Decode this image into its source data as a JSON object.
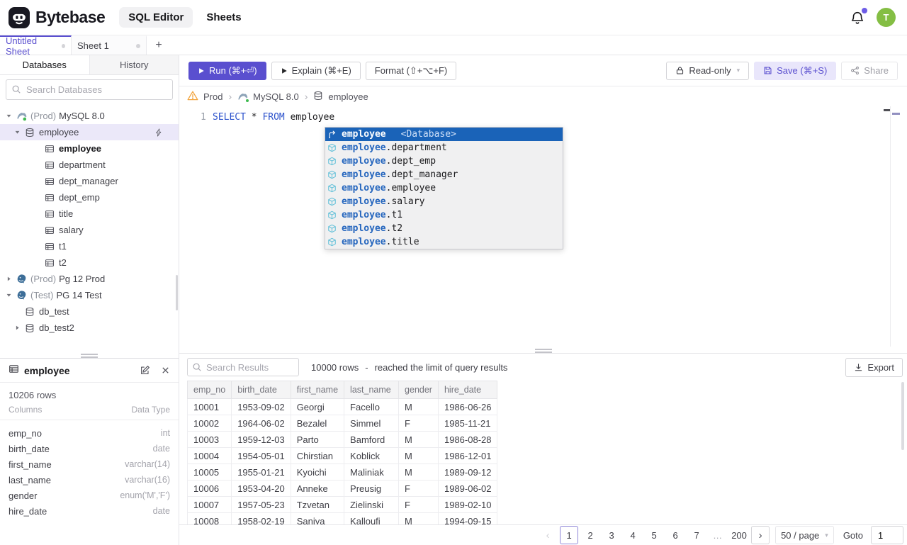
{
  "header": {
    "brand": "Bytebase",
    "nav_sql_editor": "SQL Editor",
    "nav_sheets": "Sheets",
    "avatar_initial": "T"
  },
  "sheet_tabs": {
    "tabs": [
      {
        "label": "Untitled Sheet",
        "active": true
      },
      {
        "label": "Sheet 1",
        "active": false
      }
    ],
    "add_label": "+"
  },
  "sidebar": {
    "tab_databases": "Databases",
    "tab_history": "History",
    "search_placeholder": "Search Databases",
    "tree": [
      {
        "level": 1,
        "icon": "mysql",
        "caret": "down",
        "prefix": "(Prod)",
        "label": "MySQL 8.0"
      },
      {
        "level": 2,
        "icon": "database",
        "caret": "down",
        "label": "employee",
        "selected": true,
        "bolt": true
      },
      {
        "level": 3,
        "icon": "table",
        "caret": "none",
        "label": "employee",
        "bold": true
      },
      {
        "level": 3,
        "icon": "table",
        "caret": "none",
        "label": "department"
      },
      {
        "level": 3,
        "icon": "table",
        "caret": "none",
        "label": "dept_manager"
      },
      {
        "level": 3,
        "icon": "table",
        "caret": "none",
        "label": "dept_emp"
      },
      {
        "level": 3,
        "icon": "table",
        "caret": "none",
        "label": "title"
      },
      {
        "level": 3,
        "icon": "table",
        "caret": "none",
        "label": "salary"
      },
      {
        "level": 3,
        "icon": "table",
        "caret": "none",
        "label": "t1"
      },
      {
        "level": 3,
        "icon": "table",
        "caret": "none",
        "label": "t2"
      },
      {
        "level": 1,
        "icon": "postgres",
        "caret": "right",
        "prefix": "(Prod)",
        "label": "Pg 12 Prod"
      },
      {
        "level": 1,
        "icon": "postgres",
        "caret": "down",
        "prefix": "(Test)",
        "label": "PG 14 Test"
      },
      {
        "level": 2,
        "icon": "database",
        "caret": "none",
        "label": "db_test"
      },
      {
        "level": 2,
        "icon": "database",
        "caret": "right",
        "label": "db_test2"
      }
    ]
  },
  "schema_panel": {
    "table_name": "employee",
    "row_count": "10206 rows",
    "columns_label": "Columns",
    "datatype_label": "Data Type",
    "columns": [
      {
        "name": "emp_no",
        "type": "int"
      },
      {
        "name": "birth_date",
        "type": "date"
      },
      {
        "name": "first_name",
        "type": "varchar(14)"
      },
      {
        "name": "last_name",
        "type": "varchar(16)"
      },
      {
        "name": "gender",
        "type": "enum('M','F')"
      },
      {
        "name": "hire_date",
        "type": "date"
      }
    ]
  },
  "toolbar": {
    "run_label": "Run (⌘+⏎)",
    "explain_label": "Explain (⌘+E)",
    "format_label": "Format (⇧+⌥+F)",
    "readonly_label": "Read-only",
    "save_label": "Save (⌘+S)",
    "share_label": "Share"
  },
  "breadcrumb": {
    "environment": "Prod",
    "instance": "MySQL 8.0",
    "database": "employee"
  },
  "editor": {
    "line_number": "1",
    "keyword1": "SELECT",
    "star": "*",
    "keyword2": "FROM",
    "table": "employee"
  },
  "autocomplete": {
    "selected": {
      "label": "employee",
      "detail": "<Database>"
    },
    "items": [
      {
        "prefix": "employee",
        "suffix": ".department"
      },
      {
        "prefix": "employee",
        "suffix": ".dept_emp"
      },
      {
        "prefix": "employee",
        "suffix": ".dept_manager"
      },
      {
        "prefix": "employee",
        "suffix": ".employee"
      },
      {
        "prefix": "employee",
        "suffix": ".salary"
      },
      {
        "prefix": "employee",
        "suffix": ".t1"
      },
      {
        "prefix": "employee",
        "suffix": ".t2"
      },
      {
        "prefix": "employee",
        "suffix": ".title"
      }
    ]
  },
  "results": {
    "search_placeholder": "Search Results",
    "row_count": "10000 rows",
    "separator": "-",
    "limit_note": "reached the limit of query results",
    "export_label": "Export",
    "columns": [
      "emp_no",
      "birth_date",
      "first_name",
      "last_name",
      "gender",
      "hire_date"
    ],
    "rows": [
      [
        "10001",
        "1953-09-02",
        "Georgi",
        "Facello",
        "M",
        "1986-06-26"
      ],
      [
        "10002",
        "1964-06-02",
        "Bezalel",
        "Simmel",
        "F",
        "1985-11-21"
      ],
      [
        "10003",
        "1959-12-03",
        "Parto",
        "Bamford",
        "M",
        "1986-08-28"
      ],
      [
        "10004",
        "1954-05-01",
        "Chirstian",
        "Koblick",
        "M",
        "1986-12-01"
      ],
      [
        "10005",
        "1955-01-21",
        "Kyoichi",
        "Maliniak",
        "M",
        "1989-09-12"
      ],
      [
        "10006",
        "1953-04-20",
        "Anneke",
        "Preusig",
        "F",
        "1989-06-02"
      ],
      [
        "10007",
        "1957-05-23",
        "Tzvetan",
        "Zielinski",
        "F",
        "1989-02-10"
      ],
      [
        "10008",
        "1958-02-19",
        "Saniya",
        "Kalloufi",
        "M",
        "1994-09-15"
      ]
    ]
  },
  "pagination": {
    "prev": "‹",
    "next": "›",
    "pages": [
      "1",
      "2",
      "3",
      "4",
      "5",
      "6",
      "7"
    ],
    "active_page": "1",
    "ellipsis": "…",
    "last_page": "200",
    "page_size": "50 / page",
    "goto_label": "Goto",
    "goto_value": "1"
  },
  "colors": {
    "accent": "#5a4fcf",
    "suggest_selected_bg": "#1a63b8",
    "keyword_blue": "#2c52cc",
    "avatar_bg": "#84be44",
    "status_green": "#3fba50",
    "warning_amber": "#f2a33c",
    "notification_dot": "#6d5ce6"
  }
}
